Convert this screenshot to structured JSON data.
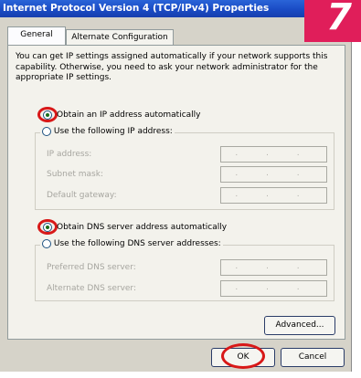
{
  "dialog": {
    "title": "Internet Protocol Version 4 (TCP/IPv4) Properties"
  },
  "step_badge": "7",
  "tabs": [
    {
      "label": "General",
      "selected": true
    },
    {
      "label": "Alternate Configuration",
      "selected": false
    }
  ],
  "description": "You can get IP settings assigned automatically if your network supports this capability. Otherwise, you need to ask your network administrator for the appropriate IP settings.",
  "ip_section": {
    "auto_label": "Obtain an IP address automatically",
    "auto_checked": true,
    "manual_label": "Use the following IP address:",
    "manual_checked": false,
    "fields": [
      {
        "label": "IP address:",
        "value": ". . ."
      },
      {
        "label": "Subnet mask:",
        "value": ". . ."
      },
      {
        "label": "Default gateway:",
        "value": ". . ."
      }
    ]
  },
  "dns_section": {
    "auto_label": "Obtain DNS server address automatically",
    "auto_checked": true,
    "manual_label": "Use the following DNS server addresses:",
    "manual_checked": false,
    "fields": [
      {
        "label": "Preferred DNS server:",
        "value": ". . ."
      },
      {
        "label": "Alternate DNS server:",
        "value": ". . ."
      }
    ]
  },
  "buttons": {
    "advanced": "Advanced...",
    "ok": "OK",
    "cancel": "Cancel"
  },
  "colors": {
    "titlebar": "#1a4bc4",
    "badge": "#e01e5a",
    "highlight_circle": "#d81818",
    "dialog_bg": "#d6d3c9"
  }
}
